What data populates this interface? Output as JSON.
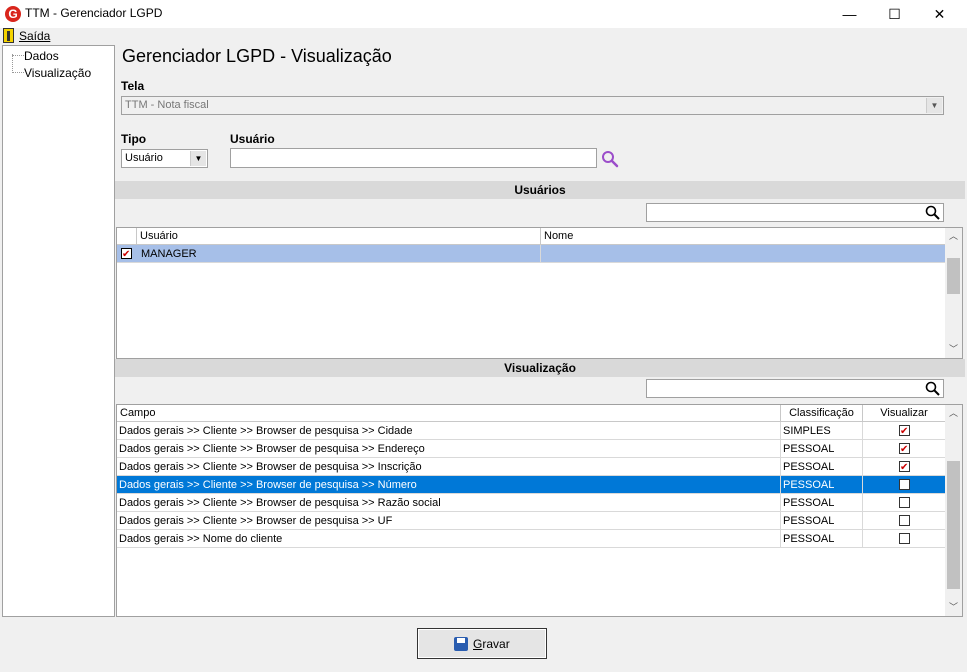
{
  "window": {
    "title": "TTM - Gerenciador LGPD",
    "minimize": "—",
    "maximize": "☐",
    "close": "✕"
  },
  "menu": {
    "exit_label": "Saída"
  },
  "tree": {
    "items": [
      "Dados",
      "Visualização"
    ]
  },
  "page": {
    "heading": "Gerenciador LGPD - Visualização"
  },
  "form": {
    "tela_label": "Tela",
    "tela_value": "TTM - Nota fiscal",
    "tipo_label": "Tipo",
    "tipo_value": "Usuário",
    "usuario_label": "Usuário",
    "usuario_value": ""
  },
  "users_section": {
    "title": "Usuários",
    "columns": [
      "Usuário",
      "Nome"
    ],
    "rows": [
      {
        "usuario": "MANAGER",
        "nome": "",
        "checked": true,
        "selected": true
      }
    ]
  },
  "view_section": {
    "title": "Visualização",
    "columns": [
      "Campo",
      "Classificação",
      "Visualizar"
    ],
    "rows": [
      {
        "campo": "Dados gerais >> Cliente >> Browser de pesquisa >> Cidade",
        "classificacao": "SIMPLES",
        "visualizar": true
      },
      {
        "campo": "Dados gerais >> Cliente >> Browser de pesquisa >> Endereço",
        "classificacao": "PESSOAL",
        "visualizar": true
      },
      {
        "campo": "Dados gerais >> Cliente >> Browser de pesquisa >> Inscrição",
        "classificacao": "PESSOAL",
        "visualizar": true
      },
      {
        "campo": "Dados gerais >> Cliente >> Browser de pesquisa >> Número",
        "classificacao": "PESSOAL",
        "visualizar": false
      },
      {
        "campo": "Dados gerais >> Cliente >> Browser de pesquisa >> Razão social",
        "classificacao": "PESSOAL",
        "visualizar": false
      },
      {
        "campo": "Dados gerais >> Cliente >> Browser de pesquisa >> UF",
        "classificacao": "PESSOAL",
        "visualizar": false
      },
      {
        "campo": "Dados gerais >> Nome do cliente",
        "classificacao": "PESSOAL",
        "visualizar": false
      }
    ],
    "selected_index": 3
  },
  "buttons": {
    "save_label": "Gravar"
  },
  "colors": {
    "selection_blue": "#0078d7",
    "user_row_highlight": "#a6bfe8",
    "section_bar": "#d9d9d9"
  }
}
